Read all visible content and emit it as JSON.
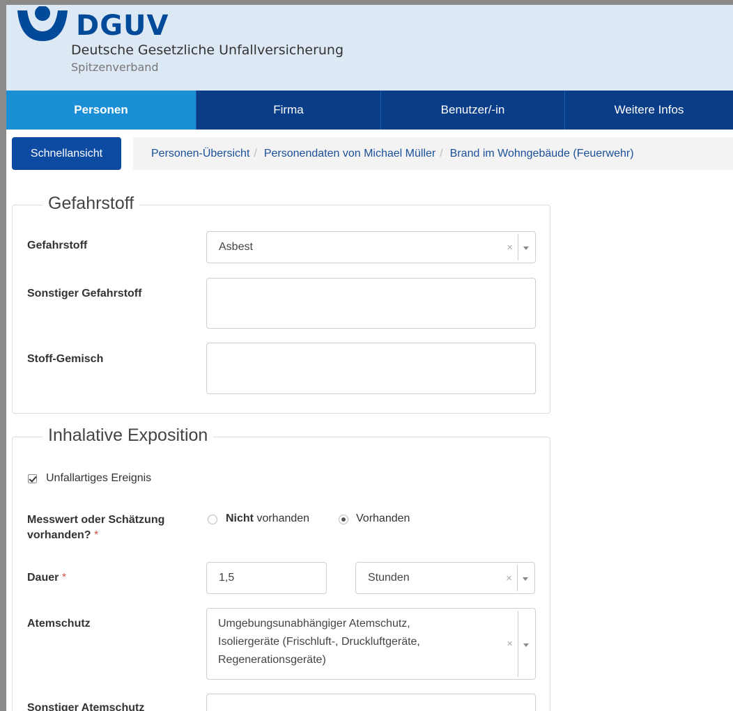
{
  "brand": {
    "name": "DGUV",
    "subtitle": "Deutsche Gesetzliche Unfallversicherung",
    "subtitle2": "Spitzenverband",
    "color": "#004a99"
  },
  "nav": {
    "items": [
      {
        "label": "Personen",
        "active": true
      },
      {
        "label": "Firma",
        "active": false
      },
      {
        "label": "Benutzer/-in",
        "active": false
      },
      {
        "label": "Weitere Infos",
        "active": false
      }
    ],
    "active_color": "#1a8fd6",
    "bg_color": "#0a3d87"
  },
  "quick_button": "Schnellansicht",
  "breadcrumb": [
    "Personen-Übersicht",
    "Personendaten von Michael Müller",
    "Brand im Wohngebäude (Feuerwehr)"
  ],
  "gefahrstoff": {
    "legend": "Gefahrstoff",
    "fields": {
      "gefahrstoff": {
        "label": "Gefahrstoff",
        "value": "Asbest"
      },
      "sonstiger": {
        "label": "Sonstiger Gefahrstoff",
        "value": ""
      },
      "gemisch": {
        "label": "Stoff-Gemisch",
        "value": ""
      }
    }
  },
  "exposition": {
    "legend": "Inhalative Exposition",
    "unfallartig": {
      "label": "Unfallartiges Ereignis",
      "checked": true
    },
    "messwert": {
      "label_line1": "Messwert oder Schätzung",
      "label_line2": "vorhanden?",
      "required_mark": "*",
      "option1_bold": "Nicht",
      "option1_rest": " vorhanden",
      "option2": "Vorhanden",
      "selected": "Vorhanden"
    },
    "dauer": {
      "label": "Dauer",
      "required_mark": "*",
      "value": "1,5",
      "unit": "Stunden"
    },
    "atemschutz": {
      "label": "Atemschutz",
      "lines": [
        "Umgebungsunabhängiger Atemschutz,",
        "Isoliergeräte (Frischluft-, Druckluftgeräte,",
        "Regenerationsgeräte)"
      ]
    },
    "sonstiger_atemschutz": {
      "label": "Sonstiger Atemschutz"
    }
  },
  "icons": {
    "clear": "×"
  }
}
